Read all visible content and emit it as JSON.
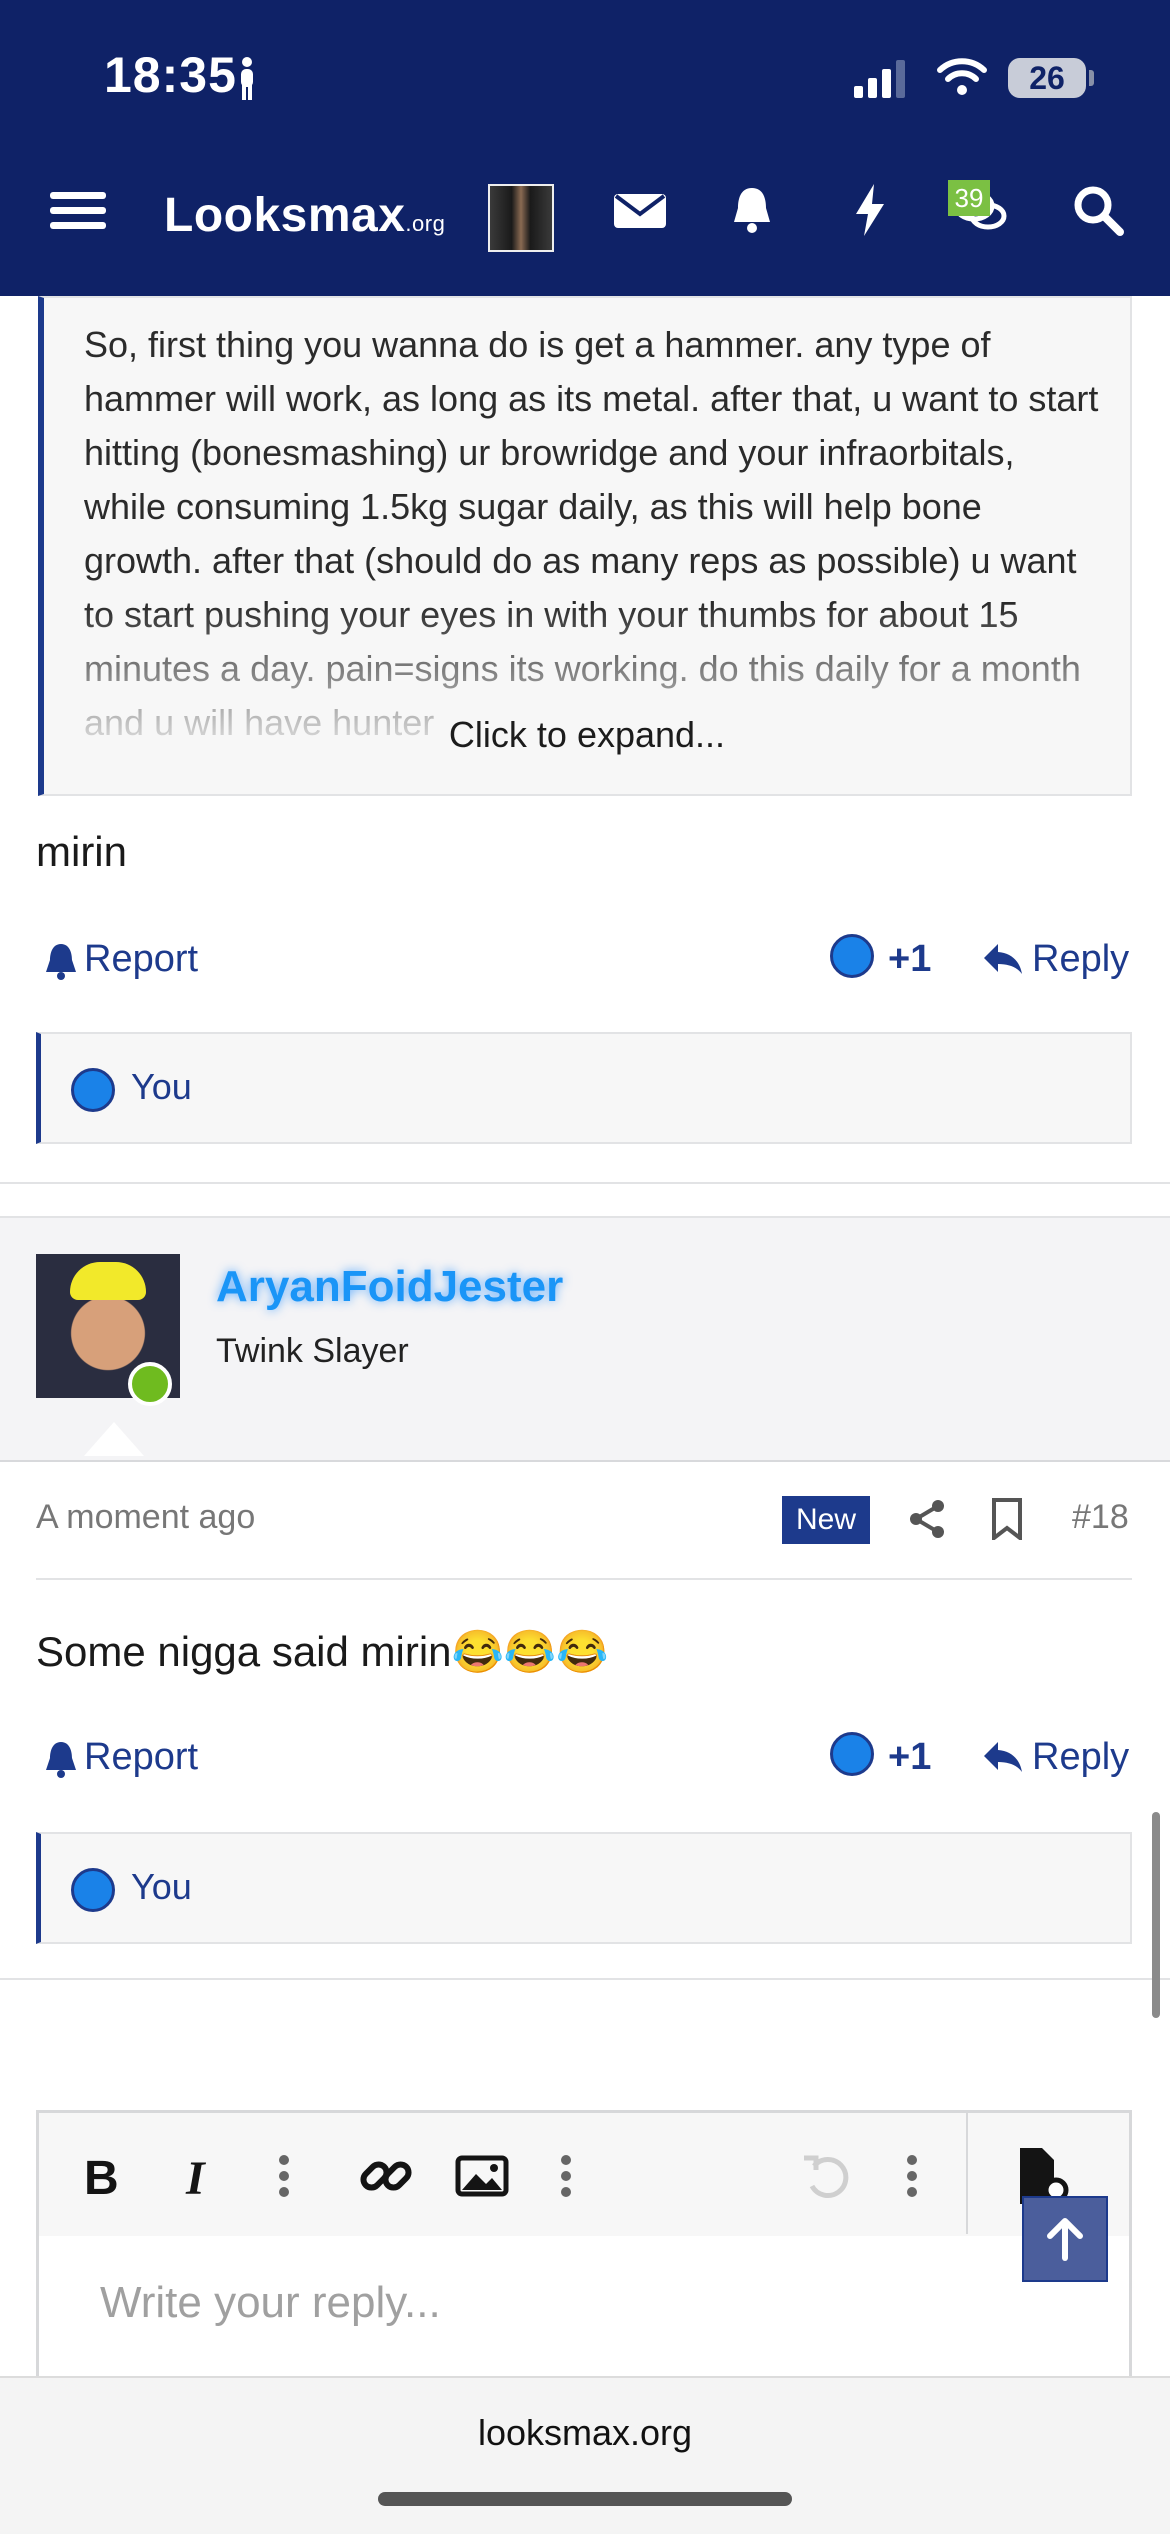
{
  "status_bar": {
    "time": "18:35",
    "battery": "26"
  },
  "nav": {
    "logo_main": "Looksmax",
    "logo_suffix": ".org",
    "messages_badge": "39"
  },
  "quote": {
    "text": "So, first thing you wanna do is get a hammer. any type of hammer will work, as long as its metal. after that, u want to start hitting (bonesmashing) ur browridge and your infraorbitals, while consuming 1.5kg sugar daily, as this will help bone growth. after that (should do as many reps as possible) u want to start pushing your eyes in with your thumbs for about 15 minutes a day. pain=signs its working. do this daily for a month and u will have hunter",
    "expand_label": "Click to expand..."
  },
  "post1": {
    "text": "mirin",
    "report_label": "Report",
    "reaction_count": "+1",
    "reply_label": "Reply",
    "likes_by": "You"
  },
  "post2": {
    "username": "AryanFoidJester",
    "user_title": "Twink Slayer",
    "time": "A moment ago",
    "new_badge": "New",
    "post_number": "#18",
    "text": "Some nigga said mirin😂😂😂",
    "report_label": "Report",
    "reaction_count": "+1",
    "reply_label": "Reply",
    "likes_by": "You"
  },
  "editor": {
    "placeholder": "Write your reply..."
  },
  "browser": {
    "domain": "looksmax.org"
  },
  "colors": {
    "nav_bg": "#0f2267",
    "accent": "#1d3a8c",
    "username": "#1a95f7",
    "online": "#6fbb1f"
  }
}
